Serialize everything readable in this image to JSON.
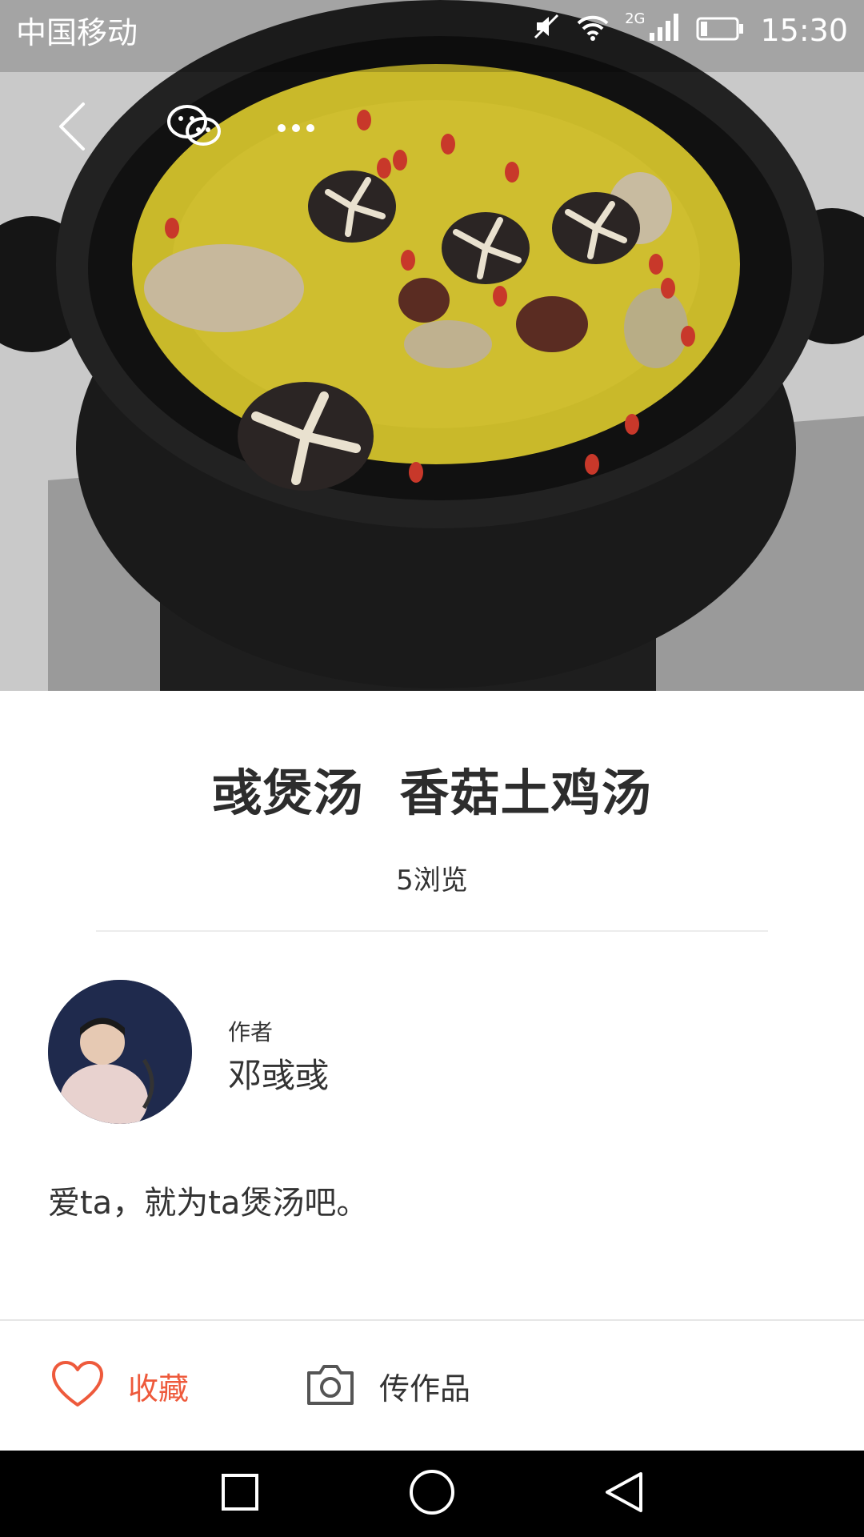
{
  "status_bar": {
    "carrier": "中国移动",
    "network": "2G",
    "time": "15:30",
    "icons": [
      "mute-icon",
      "wifi-icon",
      "signal-icon",
      "battery-icon"
    ]
  },
  "toolbar": {
    "icons": [
      "back-icon",
      "wechat-icon",
      "more-icon"
    ]
  },
  "recipe": {
    "title": "彧煲汤  香菇土鸡汤",
    "views": "5浏览"
  },
  "author": {
    "label": "作者",
    "name": "邓彧彧"
  },
  "description": "爱ta，就为ta煲汤吧。",
  "actions": {
    "favorite_label": "收藏",
    "upload_label": "传作品",
    "icons": [
      "heart-icon",
      "camera-icon"
    ]
  },
  "navbar": {
    "icons": [
      "recent-apps-icon",
      "home-icon",
      "back-nav-icon"
    ]
  },
  "colors": {
    "accent": "#ee5a3c",
    "text": "#333333",
    "navbar": "#000000"
  }
}
